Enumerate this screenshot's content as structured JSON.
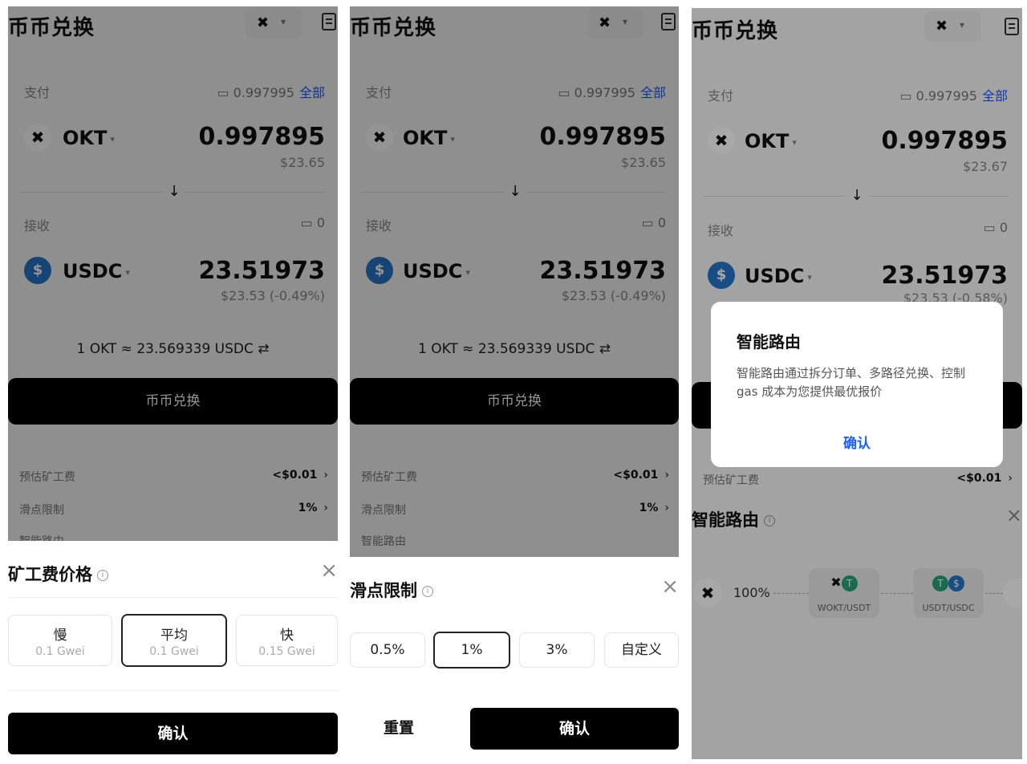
{
  "common": {
    "title": "币币兑换",
    "net_glyph": "✖",
    "caret": "▾",
    "pay_label": "支付",
    "pay_balance": "0.997995",
    "all_label": "全部",
    "pay_token": "OKT",
    "pay_amount": "0.997895",
    "receive_label": "接收",
    "receive_balance": "0",
    "receive_token": "USDC",
    "receive_amount": "23.51973",
    "rate": "1 OKT ≈ 23.569339 USDC ⇄",
    "swap_button": "币币兑换",
    "gas_label": "预估矿工费",
    "gas_value": "<$0.01",
    "slip_label": "滑点限制",
    "slip_value": "1%",
    "route_label": "智能路由",
    "down_arrow": "↓",
    "chevron": "›",
    "close": "×",
    "okt_glyph": "✖",
    "usdc_glyph": "$"
  },
  "screen1": {
    "pay_usd": "$23.65",
    "receive_usd": "$23.53 (-0.49%)",
    "sheet": {
      "title": "矿工费价格",
      "options": [
        {
          "label": "慢",
          "sub": "0.1 Gwei",
          "selected": false
        },
        {
          "label": "平均",
          "sub": "0.1 Gwei",
          "selected": true
        },
        {
          "label": "快",
          "sub": "0.15 Gwei",
          "selected": false
        }
      ],
      "confirm": "确认"
    }
  },
  "screen2": {
    "pay_usd": "$23.65",
    "receive_usd": "$23.53 (-0.49%)",
    "sheet": {
      "title": "滑点限制",
      "options": [
        "0.5%",
        "1%",
        "3%",
        "自定义"
      ],
      "selected_index": 1,
      "reset": "重置",
      "confirm": "确认"
    }
  },
  "screen3": {
    "pay_usd": "$23.67",
    "receive_usd": "$23.53 (-0.58%)",
    "dialog": {
      "title": "智能路由",
      "body": "智能路由通过拆分订单、多路径兑换、控制 gas 成本为您提供最优报价",
      "confirm": "确认"
    },
    "route": {
      "title": "智能路由",
      "percent": "100%",
      "pairs": [
        "WOKT/USDT",
        "USDT/USDC"
      ]
    }
  }
}
